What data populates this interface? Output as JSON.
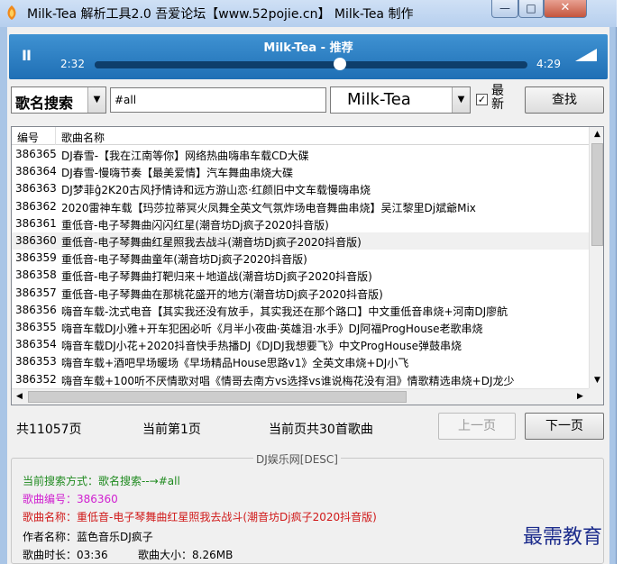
{
  "window": {
    "title": "Milk-Tea 解析工具2.0  吾爱论坛【www.52pojie.cn】 Milk-Tea 制作",
    "min_label": "—",
    "max_label": "□",
    "close_label": "✕"
  },
  "player": {
    "title": "Milk-Tea - 推荐",
    "current_time": "2:32",
    "total_time": "4:29",
    "progress": 0.566,
    "play_glyph": "II"
  },
  "search": {
    "type_value": "歌名搜索",
    "query": "#all",
    "source_value": "Milk-Tea",
    "newest_label": "最新",
    "newest_checked": true,
    "search_button": "查找"
  },
  "list": {
    "columns": [
      "编号",
      "歌曲名称"
    ],
    "selected_index": 5,
    "rows": [
      {
        "id": "386365",
        "name": "DJ春雪-【我在江南等你】网络热曲嗨串车载CD大碟"
      },
      {
        "id": "386364",
        "name": "DJ春雪-慢嗨节奏【最美爱情】汽车舞曲串烧大碟"
      },
      {
        "id": "386363",
        "name": "DJ梦菲ĝ2K20古风抒情诗和远方游山恋·红颜旧中文车载慢嗨串烧"
      },
      {
        "id": "386362",
        "name": "2020雷神车载【玛莎拉蒂冥火凤舞全英文气氛炸场电音舞曲串烧】吴江黎里Dj斌爺Mix"
      },
      {
        "id": "386361",
        "name": "重低音-电子琴舞曲闪闪红星(潮音坊Dj疯子2020抖音版)"
      },
      {
        "id": "386360",
        "name": "重低音-电子琴舞曲红星照我去战斗(潮音坊Dj疯子2020抖音版)"
      },
      {
        "id": "386359",
        "name": "重低音-电子琴舞曲童年(潮音坊Dj疯子2020抖音版)"
      },
      {
        "id": "386358",
        "name": "重低音-电子琴舞曲打靶归来＋地道战(潮音坊Dj疯子2020抖音版)"
      },
      {
        "id": "386357",
        "name": "重低音-电子琴舞曲在那桃花盛开的地方(潮音坊Dj疯子2020抖音版)"
      },
      {
        "id": "386356",
        "name": "嗨音车载-沈式电音【其实我还没有放手，其实我还在那个路口】中文重低音串烧+河南DJ廖航"
      },
      {
        "id": "386355",
        "name": "嗨音车载DJ小雅+开车犯困必听《月半小夜曲·英雄泪·水手》DJ阿福ProgHouse老歌串烧"
      },
      {
        "id": "386354",
        "name": "嗨音车载DJ小花+2020抖音快手热播DJ《DJDJ我想要飞》中文ProgHouse弹鼓串烧"
      },
      {
        "id": "386353",
        "name": "嗨音车载+酒吧早场暖场《早场精品House思路v1》全英文串烧+DJ小飞"
      },
      {
        "id": "386352",
        "name": "嗨音车载+100听不厌情歌对唱《情哥去南方vs选择vs谁说梅花没有泪》情歌精选串烧+DJ龙少"
      }
    ]
  },
  "pager": {
    "total_pages": "共11057页",
    "current_page": "当前第1页",
    "songs_on_page": "当前页共30首歌曲",
    "prev_button": "上一页",
    "next_button": "下一页"
  },
  "info": {
    "group_title": "DJ娱乐网[DESC]",
    "search_mode": "当前搜索方式：歌名搜索--→#all",
    "song_id": "歌曲编号：386360",
    "song_name": "歌曲名称：重低音-电子琴舞曲红星照我去战斗(潮音坊Dj疯子2020抖音版)",
    "author": "作者名称：蓝色音乐DJ疯子",
    "duration": "歌曲时长：03:36",
    "size": "歌曲大小：8.26MB"
  },
  "watermark": "最需教育",
  "colors": {
    "player_blue": "#2a7fc6",
    "search_mode": "#1f8a1f",
    "song_id": "#d020d0",
    "song_name": "#d01818"
  }
}
